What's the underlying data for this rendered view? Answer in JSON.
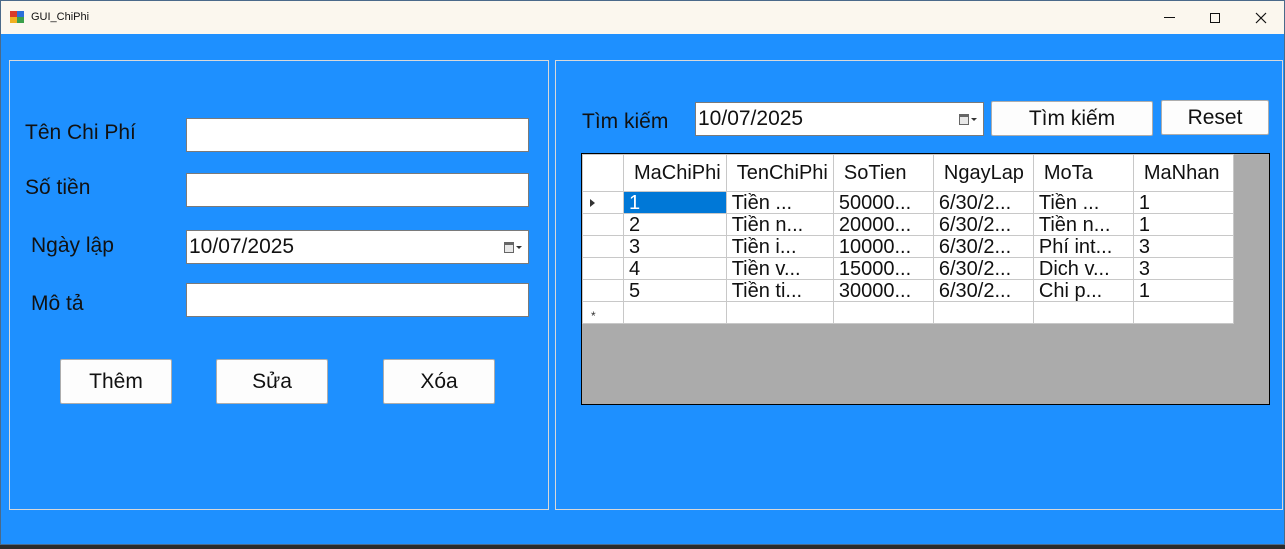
{
  "window": {
    "title": "GUI_ChiPhi"
  },
  "form": {
    "ten_chi_phi_label": "Tên Chi Phí",
    "ten_chi_phi_value": "",
    "so_tien_label": "Số tiền",
    "so_tien_value": "",
    "ngay_lap_label": "Ngày lập",
    "ngay_lap_value": "10/07/2025",
    "mo_ta_label": "Mô tả",
    "mo_ta_value": ""
  },
  "actions": {
    "them": "Thêm",
    "sua": "Sửa",
    "xoa": "Xóa"
  },
  "search": {
    "label": "Tìm kiếm",
    "date_value": "10/07/2025",
    "search_button": "Tìm kiếm",
    "reset_button": "Reset"
  },
  "grid": {
    "columns": [
      "MaChiPhi",
      "TenChiPhi",
      "SoTien",
      "NgayLap",
      "MoTa",
      "MaNhan"
    ],
    "rows": [
      [
        "1",
        "Tiền ...",
        "50000...",
        "6/30/2...",
        "Tiền ...",
        "1"
      ],
      [
        "2",
        "Tiền n...",
        "20000...",
        "6/30/2...",
        "Tiền n...",
        "1"
      ],
      [
        "3",
        "Tiền i...",
        "10000...",
        "6/30/2...",
        "Phí int...",
        "3"
      ],
      [
        "4",
        "Tiền v...",
        "15000...",
        "6/30/2...",
        "Dich v...",
        "3"
      ],
      [
        "5",
        "Tiền ti...",
        "30000...",
        "6/30/2...",
        "Chi p...",
        "1"
      ]
    ],
    "selected_row": 0,
    "selected_color": "#0078d7"
  },
  "colors": {
    "form_background": "#1e90ff",
    "grid_background": "#ababab"
  }
}
